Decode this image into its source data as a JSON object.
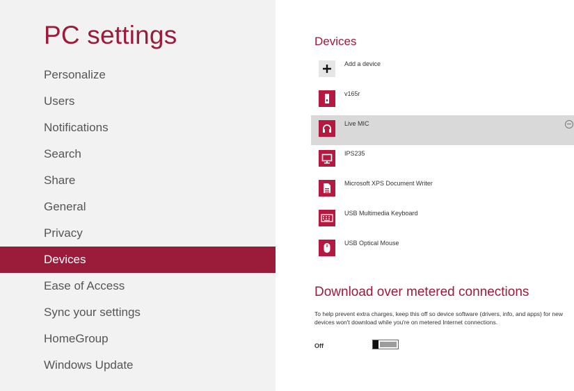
{
  "app": {
    "title": "PC settings"
  },
  "nav": {
    "items": [
      {
        "label": "Personalize"
      },
      {
        "label": "Users"
      },
      {
        "label": "Notifications"
      },
      {
        "label": "Search"
      },
      {
        "label": "Share"
      },
      {
        "label": "General"
      },
      {
        "label": "Privacy"
      },
      {
        "label": "Devices",
        "selected": true
      },
      {
        "label": "Ease of Access"
      },
      {
        "label": "Sync your settings"
      },
      {
        "label": "HomeGroup"
      },
      {
        "label": "Windows Update"
      }
    ]
  },
  "devices": {
    "title": "Devices",
    "items": [
      {
        "label": "Add a device",
        "icon": "plus-icon"
      },
      {
        "label": "v165r",
        "icon": "drive-icon"
      },
      {
        "label": "Live MIC",
        "icon": "headset-icon",
        "selected": true
      },
      {
        "label": "IPS235",
        "icon": "monitor-icon"
      },
      {
        "label": "Microsoft XPS Document Writer",
        "icon": "printer-icon"
      },
      {
        "label": "USB Multimedia Keyboard",
        "icon": "keyboard-icon"
      },
      {
        "label": "USB Optical Mouse",
        "icon": "mouse-icon"
      }
    ]
  },
  "metered": {
    "title": "Download over metered connections",
    "description": "To help prevent extra charges, keep this off so device software (drivers, info, and apps) for new devices won't download while you're on metered Internet connections.",
    "toggle_label": "Off",
    "toggle_on": false
  },
  "colors": {
    "accent": "#9b1b3a",
    "tile": "#b5193f",
    "pane": "#f2f2f2",
    "selection": "#d9d9d9"
  }
}
